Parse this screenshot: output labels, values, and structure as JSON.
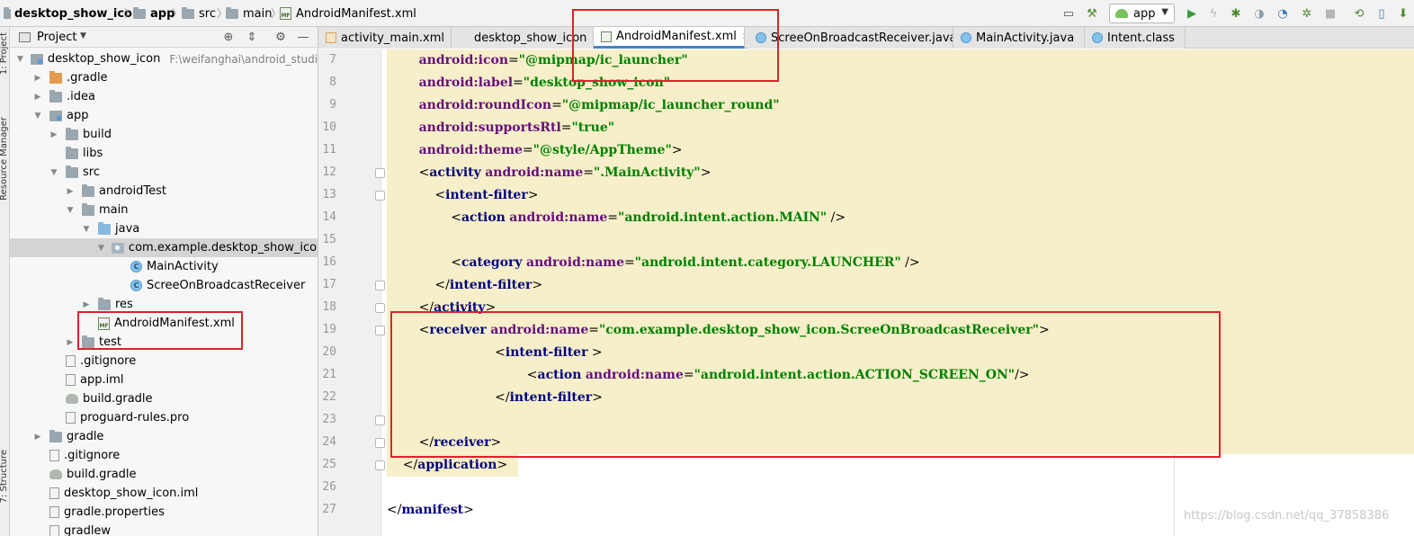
{
  "breadcrumb": {
    "project": "desktop_show_icon",
    "module": "app",
    "src": "src",
    "main": "main",
    "file": "AndroidManifest.xml"
  },
  "toolbar": {
    "run_config": "app"
  },
  "side_tabs": {
    "project": "1: Project",
    "resource_manager": "Resource Manager",
    "structure": "7: Structure"
  },
  "project_panel": {
    "title": "Project",
    "items": [
      {
        "label": "desktop_show_icon",
        "path": "F:\\weifanghai\\android_studio_a",
        "arrow": "down",
        "icon": "module"
      },
      {
        "label": ".gradle",
        "arrow": "right",
        "icon": "folder-orange"
      },
      {
        "label": ".idea",
        "arrow": "right",
        "icon": "folder"
      },
      {
        "label": "app",
        "arrow": "down",
        "icon": "module"
      },
      {
        "label": "build",
        "arrow": "right",
        "icon": "folder"
      },
      {
        "label": "libs",
        "arrow": "none",
        "icon": "folder"
      },
      {
        "label": "src",
        "arrow": "down",
        "icon": "folder"
      },
      {
        "label": "androidTest",
        "arrow": "right",
        "icon": "folder"
      },
      {
        "label": "main",
        "arrow": "down",
        "icon": "folder"
      },
      {
        "label": "java",
        "arrow": "down",
        "icon": "folder-blue"
      },
      {
        "label": "com.example.desktop_show_icon",
        "arrow": "down",
        "icon": "pkg"
      },
      {
        "label": "MainActivity",
        "arrow": "none",
        "icon": "cls"
      },
      {
        "label": "ScreeOnBroadcastReceiver",
        "arrow": "none",
        "icon": "cls"
      },
      {
        "label": "res",
        "arrow": "right",
        "icon": "folder"
      },
      {
        "label": "AndroidManifest.xml",
        "arrow": "none",
        "icon": "mf"
      },
      {
        "label": "test",
        "arrow": "right",
        "icon": "folder"
      },
      {
        "label": ".gitignore",
        "arrow": "none",
        "icon": "file"
      },
      {
        "label": "app.iml",
        "arrow": "none",
        "icon": "file"
      },
      {
        "label": "build.gradle",
        "arrow": "none",
        "icon": "gradle"
      },
      {
        "label": "proguard-rules.pro",
        "arrow": "none",
        "icon": "file"
      },
      {
        "label": "gradle",
        "arrow": "right",
        "icon": "folder"
      },
      {
        "label": ".gitignore",
        "arrow": "none",
        "icon": "file"
      },
      {
        "label": "build.gradle",
        "arrow": "none",
        "icon": "gradle"
      },
      {
        "label": "desktop_show_icon.iml",
        "arrow": "none",
        "icon": "file"
      },
      {
        "label": "gradle.properties",
        "arrow": "none",
        "icon": "file"
      },
      {
        "label": "gradlew",
        "arrow": "none",
        "icon": "file"
      }
    ]
  },
  "editor_tabs": [
    {
      "label": "activity_main.xml",
      "icon": "xml",
      "active": false
    },
    {
      "label": "desktop_show_icon",
      "icon": "gradle",
      "active": false
    },
    {
      "label": "AndroidManifest.xml",
      "icon": "mf",
      "active": true
    },
    {
      "label": "ScreeOnBroadcastReceiver.java",
      "icon": "cls",
      "active": false
    },
    {
      "label": "MainActivity.java",
      "icon": "cls",
      "active": false
    },
    {
      "label": "Intent.class",
      "icon": "cls",
      "active": false
    }
  ],
  "code": [
    {
      "n": "7",
      "tokens": [
        [
          "plain",
          "        "
        ],
        [
          "attr",
          "android:icon"
        ],
        [
          "eq",
          "="
        ],
        [
          "val",
          "\"@mipmap/ic_launcher\""
        ]
      ]
    },
    {
      "n": "8",
      "tokens": [
        [
          "plain",
          "        "
        ],
        [
          "attr",
          "android:label"
        ],
        [
          "eq",
          "="
        ],
        [
          "val",
          "\"desktop_show_icon\""
        ]
      ]
    },
    {
      "n": "9",
      "tokens": [
        [
          "plain",
          "        "
        ],
        [
          "attr",
          "android:roundIcon"
        ],
        [
          "eq",
          "="
        ],
        [
          "val",
          "\"@mipmap/ic_launcher_round\""
        ]
      ]
    },
    {
      "n": "10",
      "tokens": [
        [
          "plain",
          "        "
        ],
        [
          "attr",
          "android:supportsRtl"
        ],
        [
          "eq",
          "="
        ],
        [
          "val",
          "\"true\""
        ]
      ]
    },
    {
      "n": "11",
      "tokens": [
        [
          "plain",
          "        "
        ],
        [
          "attr",
          "android:theme"
        ],
        [
          "eq",
          "="
        ],
        [
          "val",
          "\"@style/AppTheme\""
        ],
        [
          "plain",
          ">"
        ]
      ]
    },
    {
      "n": "12",
      "tokens": [
        [
          "plain",
          "        <"
        ],
        [
          "tag",
          "activity"
        ],
        [
          "plain",
          " "
        ],
        [
          "attr",
          "android:name"
        ],
        [
          "eq",
          "="
        ],
        [
          "val",
          "\".MainActivity\""
        ],
        [
          "plain",
          ">"
        ]
      ]
    },
    {
      "n": "13",
      "tokens": [
        [
          "plain",
          "            <"
        ],
        [
          "tag",
          "intent-filter"
        ],
        [
          "plain",
          ">"
        ]
      ]
    },
    {
      "n": "14",
      "tokens": [
        [
          "plain",
          "                <"
        ],
        [
          "tag",
          "action"
        ],
        [
          "plain",
          " "
        ],
        [
          "attr",
          "android:name"
        ],
        [
          "eq",
          "="
        ],
        [
          "val",
          "\"android.intent.action.MAIN\""
        ],
        [
          "plain",
          " />"
        ]
      ]
    },
    {
      "n": "15",
      "tokens": [
        [
          "plain",
          ""
        ]
      ]
    },
    {
      "n": "16",
      "tokens": [
        [
          "plain",
          "                <"
        ],
        [
          "tag",
          "category"
        ],
        [
          "plain",
          " "
        ],
        [
          "attr",
          "android:name"
        ],
        [
          "eq",
          "="
        ],
        [
          "val",
          "\"android.intent.category.LAUNCHER\""
        ],
        [
          "plain",
          " />"
        ]
      ]
    },
    {
      "n": "17",
      "tokens": [
        [
          "plain",
          "            </"
        ],
        [
          "tag",
          "intent-filter"
        ],
        [
          "plain",
          ">"
        ]
      ]
    },
    {
      "n": "18",
      "tokens": [
        [
          "plain",
          "        </"
        ],
        [
          "tag",
          "activity"
        ],
        [
          "plain",
          ">"
        ]
      ]
    },
    {
      "n": "19",
      "tokens": [
        [
          "plain",
          "        <"
        ],
        [
          "tag",
          "receiver"
        ],
        [
          "plain",
          " "
        ],
        [
          "attr",
          "android:name"
        ],
        [
          "eq",
          "="
        ],
        [
          "val",
          "\"com.example.desktop_show_icon.ScreeOnBroadcastReceiver\""
        ],
        [
          "plain",
          ">"
        ]
      ]
    },
    {
      "n": "20",
      "tokens": [
        [
          "plain",
          "                           <"
        ],
        [
          "tag",
          "intent-filter"
        ],
        [
          "plain",
          " >"
        ]
      ]
    },
    {
      "n": "21",
      "tokens": [
        [
          "plain",
          "                                   <"
        ],
        [
          "tag",
          "action"
        ],
        [
          "plain",
          " "
        ],
        [
          "attr",
          "android:name"
        ],
        [
          "eq",
          "="
        ],
        [
          "val",
          "\"android.intent.action.ACTION_SCREEN_ON\""
        ],
        [
          "plain",
          "/>"
        ]
      ]
    },
    {
      "n": "22",
      "tokens": [
        [
          "plain",
          "                           </"
        ],
        [
          "tag",
          "intent-filter"
        ],
        [
          "plain",
          ">"
        ]
      ]
    },
    {
      "n": "23",
      "tokens": [
        [
          "plain",
          ""
        ]
      ]
    },
    {
      "n": "24",
      "tokens": [
        [
          "plain",
          "        </"
        ],
        [
          "tag",
          "receiver"
        ],
        [
          "plain",
          ">"
        ]
      ]
    },
    {
      "n": "25",
      "tokens": [
        [
          "plain",
          "    </"
        ],
        [
          "tag",
          "application"
        ],
        [
          "plain",
          ">"
        ]
      ]
    },
    {
      "n": "26",
      "tokens": [
        [
          "plain",
          ""
        ]
      ]
    },
    {
      "n": "27",
      "tokens": [
        [
          "plain",
          "</"
        ],
        [
          "tag",
          "manifest"
        ],
        [
          "plain",
          ">"
        ]
      ]
    }
  ],
  "watermark": "https://blog.csdn.net/qq_37858386",
  "colors": {
    "annotation_red": "#e0212b",
    "highlight_bg": "#f6efc9",
    "tag": "#000080",
    "attr": "#660e7a",
    "value": "#008000"
  }
}
